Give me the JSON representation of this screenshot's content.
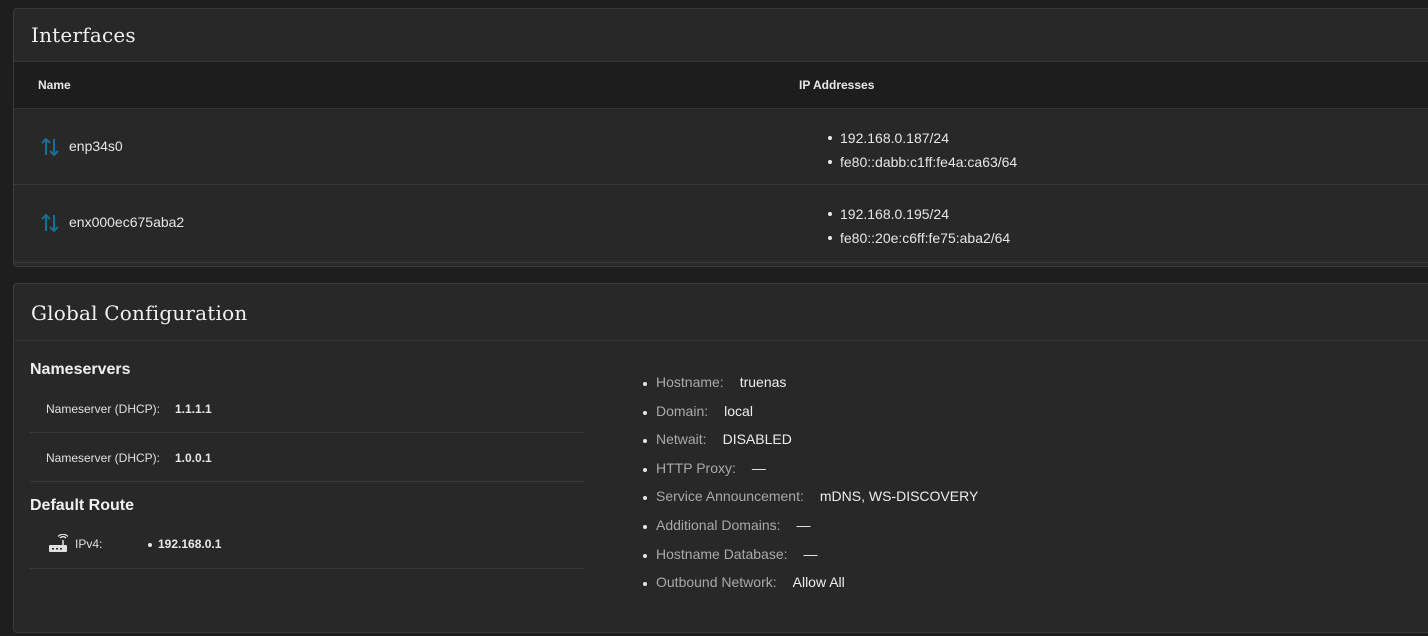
{
  "interfaces": {
    "title": "Interfaces",
    "columns": {
      "name": "Name",
      "ip": "IP Addresses"
    },
    "rows": [
      {
        "name": "enp34s0",
        "ips": [
          "192.168.0.187/24",
          "fe80::dabb:c1ff:fe4a:ca63/64"
        ],
        "icon": "up-down-arrows-icon"
      },
      {
        "name": "enx000ec675aba2",
        "ips": [
          "192.168.0.195/24",
          "fe80::20e:c6ff:fe75:aba2/64"
        ],
        "icon": "up-down-arrows-icon"
      }
    ]
  },
  "global": {
    "title": "Global Configuration",
    "nameservers": {
      "title": "Nameservers",
      "items": [
        {
          "label": "Nameserver (DHCP):",
          "value": "1.1.1.1"
        },
        {
          "label": "Nameserver (DHCP):",
          "value": "1.0.0.1"
        }
      ]
    },
    "default_route": {
      "title": "Default Route",
      "label": "IPv4:",
      "value": "192.168.0.1",
      "icon": "router-icon"
    },
    "info": [
      {
        "label": "Hostname:",
        "value": "truenas"
      },
      {
        "label": "Domain:",
        "value": "local"
      },
      {
        "label": "Netwait:",
        "value": "DISABLED"
      },
      {
        "label": "HTTP Proxy:",
        "value": "—"
      },
      {
        "label": "Service Announcement:",
        "value": "mDNS, WS-DISCOVERY"
      },
      {
        "label": "Additional Domains:",
        "value": "—"
      },
      {
        "label": "Hostname Database:",
        "value": "—"
      },
      {
        "label": "Outbound Network:",
        "value": "Allow All"
      }
    ]
  },
  "colors": {
    "background": "#1e1e1e",
    "card": "#282828",
    "icon_accent": "#1c6e91"
  }
}
